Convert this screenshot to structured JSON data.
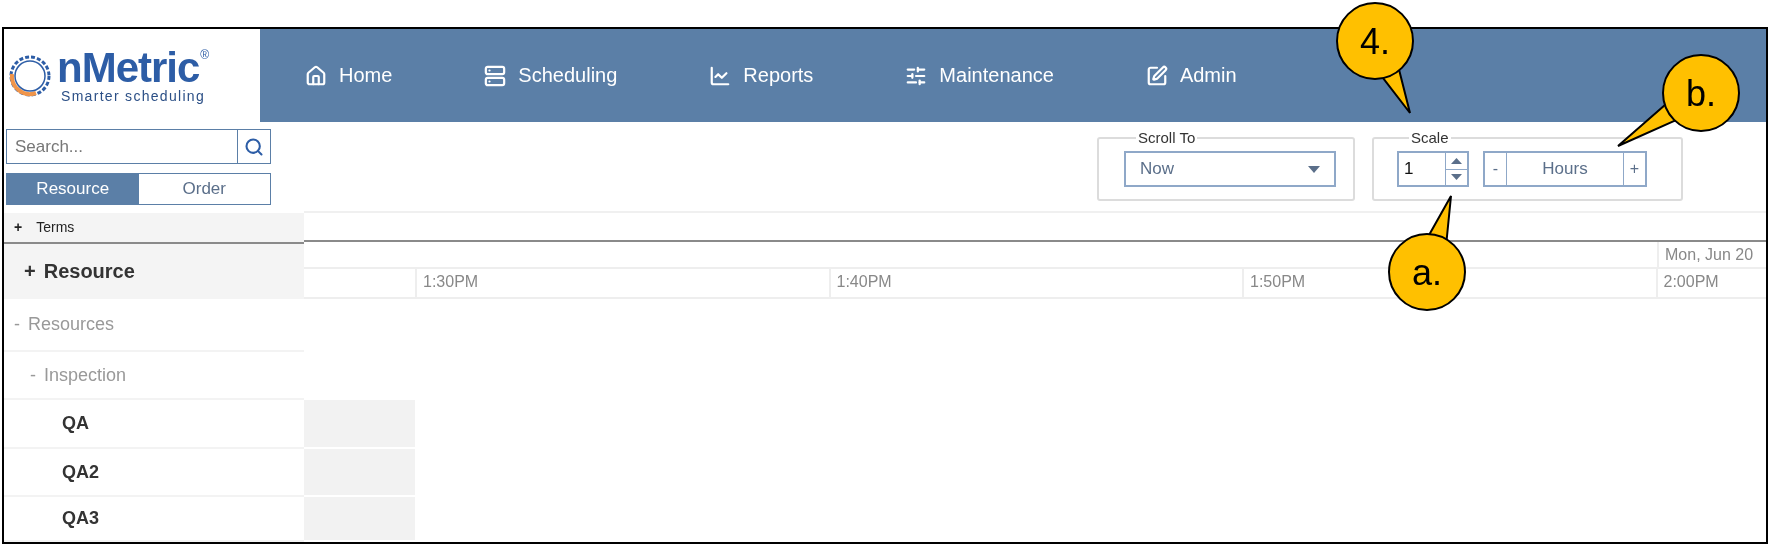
{
  "logo": {
    "name": "nMetric",
    "mark": "®",
    "tagline": "Smarter scheduling"
  },
  "nav": [
    {
      "label": "Home",
      "kind": "home"
    },
    {
      "label": "Scheduling",
      "kind": "scheduling"
    },
    {
      "label": "Reports",
      "kind": "reports"
    },
    {
      "label": "Maintenance",
      "kind": "maintenance"
    },
    {
      "label": "Admin",
      "kind": "admin"
    }
  ],
  "search": {
    "placeholder": "Search..."
  },
  "view_tabs": [
    {
      "label": "Resource",
      "selected": true
    },
    {
      "label": "Order",
      "selected": false
    }
  ],
  "scroll_to": {
    "legend": "Scroll To",
    "value": "Now"
  },
  "scale": {
    "legend": "Scale",
    "value": "1",
    "minus": "-",
    "unit": "Hours",
    "plus": "+"
  },
  "terms": {
    "toggle": "+",
    "label": "Terms"
  },
  "resource_header": {
    "toggle": "+",
    "label": "Resource"
  },
  "tree": [
    {
      "toggle": "-",
      "label": "Resources",
      "children": [
        {
          "toggle": "-",
          "label": "Inspection",
          "children": [
            {
              "label": "QA"
            },
            {
              "label": "QA2"
            },
            {
              "label": "QA3"
            }
          ]
        }
      ]
    }
  ],
  "timeline": {
    "date": "Mon, Jun 20",
    "times": [
      "1:30PM",
      "1:40PM",
      "1:50PM",
      "2:00PM"
    ]
  },
  "callouts": [
    {
      "label": "4."
    },
    {
      "label": "b."
    },
    {
      "label": "a."
    }
  ]
}
